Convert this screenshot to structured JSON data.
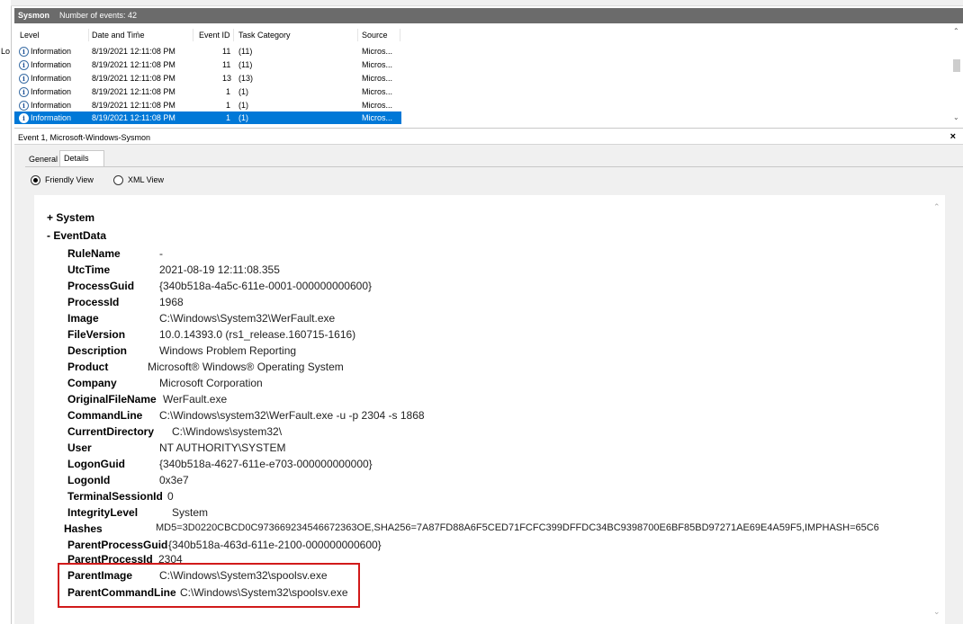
{
  "left_strip_label": "Lo",
  "log": {
    "name": "Sysmon",
    "event_count": "Number of events: 42"
  },
  "columns": [
    "Level",
    "Date and Time",
    "Event ID",
    "Task Category",
    "Source"
  ],
  "events": [
    {
      "level": "Information",
      "datetime": "8/19/2021 12:11:08 PM",
      "event_id": "11",
      "task": "(11)",
      "source": "Micros..."
    },
    {
      "level": "Information",
      "datetime": "8/19/2021 12:11:08 PM",
      "event_id": "11",
      "task": "(11)",
      "source": "Micros..."
    },
    {
      "level": "Information",
      "datetime": "8/19/2021 12:11:08 PM",
      "event_id": "13",
      "task": "(13)",
      "source": "Micros..."
    },
    {
      "level": "Information",
      "datetime": "8/19/2021 12:11:08 PM",
      "event_id": "1",
      "task": "(1)",
      "source": "Micros..."
    },
    {
      "level": "Information",
      "datetime": "8/19/2021 12:11:08 PM",
      "event_id": "1",
      "task": "(1)",
      "source": "Micros..."
    },
    {
      "level": "Information",
      "datetime": "8/19/2021 12:11:08 PM",
      "event_id": "1",
      "task": "(1)",
      "source": "Micros..."
    }
  ],
  "selected_event_index": 5,
  "detail": {
    "title": "Event 1, Microsoft-Windows-Sysmon",
    "close": "×",
    "tabs": [
      "General",
      "Details"
    ],
    "active_tab": "Details",
    "views": [
      "Friendly View",
      "XML View"
    ],
    "selected_view": "Friendly View",
    "system_label": "+ System",
    "eventdata_label": "- EventData",
    "fields": [
      {
        "name": "RuleName",
        "value": "-"
      },
      {
        "name": "UtcTime",
        "value": "2021-08-19 12:11:08.355"
      },
      {
        "name": "ProcessGuid",
        "value": "{340b518a-4a5c-611e-0001-000000000600}"
      },
      {
        "name": "ProcessId",
        "value": "1968"
      },
      {
        "name": "Image",
        "value": "C:\\Windows\\System32\\WerFault.exe"
      },
      {
        "name": "FileVersion",
        "value": "10.0.14393.0 (rs1_release.160715-1616)"
      },
      {
        "name": "Description",
        "value": "Windows Problem Reporting"
      },
      {
        "name": "Product",
        "value": "Microsoft® Windows® Operating System"
      },
      {
        "name": "Company",
        "value": "Microsoft Corporation"
      },
      {
        "name": "OriginalFileName",
        "value": "WerFault.exe"
      },
      {
        "name": "CommandLine",
        "value": "C:\\Windows\\system32\\WerFault.exe -u -p 2304 -s 1868"
      },
      {
        "name": "CurrentDirectory",
        "value": "C:\\Windows\\system32\\"
      },
      {
        "name": "User",
        "value": "NT AUTHORITY\\SYSTEM"
      },
      {
        "name": "LogonGuid",
        "value": "{340b518a-4627-611e-e703-000000000000}"
      },
      {
        "name": "LogonId",
        "value": "0x3e7"
      },
      {
        "name": "TerminalSessionId",
        "value": "0"
      },
      {
        "name": "IntegrityLevel",
        "value": "System"
      },
      {
        "name": "Hashes",
        "value": "MD5=3D0220CBCD0C973669234546672363OE,SHA256=7A87FD88A6F5CED71FCFC399DFFDC34BC9398700E6BF85BD97271AE69E4A59F5,IMPHASH=65C6"
      },
      {
        "name": "ParentProcessGuid",
        "value": "{340b518a-463d-611e-2100-000000000600}"
      },
      {
        "name": "ParentProcessId",
        "value": "2304"
      },
      {
        "name": "ParentImage",
        "value": "C:\\Windows\\System32\\spoolsv.exe"
      },
      {
        "name": "ParentCommandLine",
        "value": "C:\\Windows\\System32\\spoolsv.exe"
      }
    ],
    "highlighted_fields": [
      "ParentImage",
      "ParentCommandLine"
    ],
    "highlight_color": "#d11a1a"
  },
  "colors": {
    "titlebar": "#6b6b6b",
    "selection": "#0078d7",
    "pane_bg": "#f0f0f0"
  }
}
